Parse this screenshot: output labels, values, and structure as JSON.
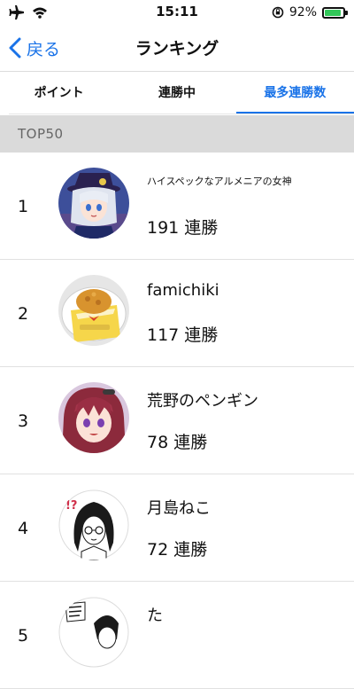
{
  "status_bar": {
    "time": "15:11",
    "battery_percent": "92%",
    "battery_level": 0.92,
    "icons": [
      "airplane-icon",
      "wifi-icon",
      "orientation-lock-icon",
      "battery-icon"
    ]
  },
  "nav": {
    "back_label": "戻る",
    "title": "ランキング"
  },
  "tabs": [
    {
      "label": "ポイント",
      "active": false
    },
    {
      "label": "連勝中",
      "active": false
    },
    {
      "label": "最多連勝数",
      "active": true
    }
  ],
  "section": {
    "header": "TOP50"
  },
  "rankings": [
    {
      "rank": "1",
      "name": "ハイスペックなアルメニアの女神",
      "streak": "191 連勝"
    },
    {
      "rank": "2",
      "name": "famichiki",
      "streak": "117 連勝"
    },
    {
      "rank": "3",
      "name": "荒野のペンギン",
      "streak": "78 連勝"
    },
    {
      "rank": "4",
      "name": "月島ねこ",
      "streak": "72 連勝"
    },
    {
      "rank": "5",
      "name": "た",
      "streak": ""
    }
  ],
  "colors": {
    "accent": "#1a73e8",
    "section_bg": "#dadada"
  }
}
